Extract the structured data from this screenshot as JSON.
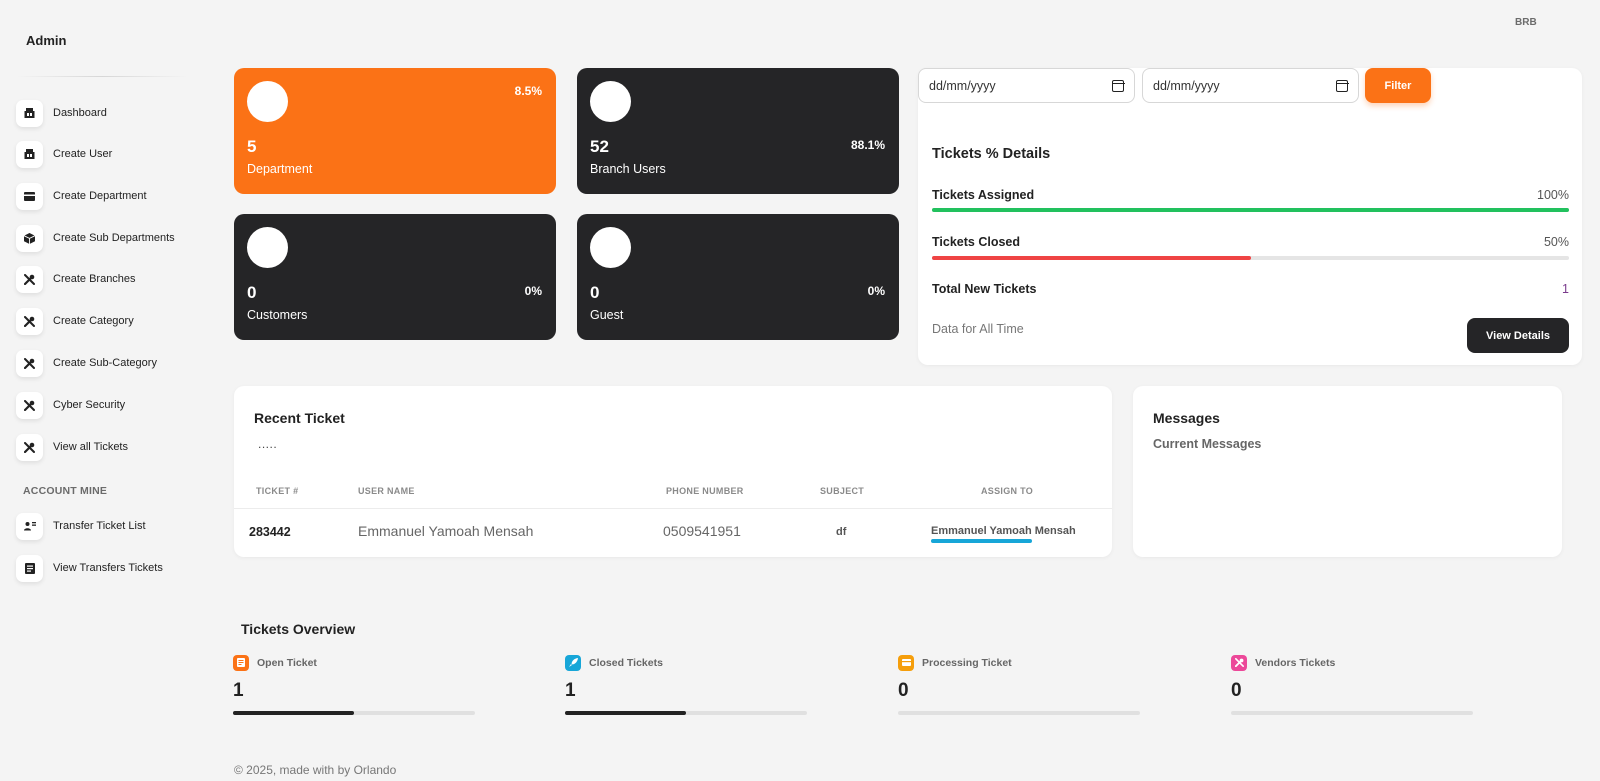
{
  "sidebar": {
    "brand": "Admin",
    "items": [
      {
        "label": "Dashboard",
        "icon": "shop-icon"
      },
      {
        "label": "Create User",
        "icon": "shop-icon"
      },
      {
        "label": "Create Department",
        "icon": "credit-card-icon"
      },
      {
        "label": "Create Sub Departments",
        "icon": "box-icon"
      },
      {
        "label": "Create Branches",
        "icon": "tools-icon"
      },
      {
        "label": "Create Category",
        "icon": "tools-icon"
      },
      {
        "label": "Create Sub-Category",
        "icon": "tools-icon"
      },
      {
        "label": "Cyber Security",
        "icon": "tools-icon"
      },
      {
        "label": "View all Tickets",
        "icon": "tools-icon"
      }
    ],
    "section_label": "ACCOUNT MINE",
    "account_items": [
      {
        "label": "Transfer Ticket List",
        "icon": "user-transfer-icon"
      },
      {
        "label": "View Transfers Tickets",
        "icon": "document-icon"
      }
    ]
  },
  "header": {
    "user": "BRB"
  },
  "stats": [
    {
      "value": "5",
      "label": "Department",
      "percent": "8.5%",
      "color": "#fb7216"
    },
    {
      "value": "52",
      "label": "Branch Users",
      "percent": "88.1%",
      "color": "#252527"
    },
    {
      "value": "0",
      "label": "Customers",
      "percent": "0%",
      "color": "#252527"
    },
    {
      "value": "0",
      "label": "Guest",
      "percent": "0%",
      "color": "#252527"
    }
  ],
  "filter": {
    "start_placeholder": "dd/mm/yyyy",
    "end_placeholder": "dd/mm/yyyy",
    "button_label": "Filter"
  },
  "tickets_percent": {
    "title": "Tickets % Details",
    "assigned": {
      "label": "Tickets Assigned",
      "value": "100%",
      "fraction": 1.0,
      "color": "#22c15e"
    },
    "closed": {
      "label": "Tickets Closed",
      "value": "50%",
      "fraction": 0.5,
      "color": "#ef4444"
    },
    "total_new": {
      "label": "Total New Tickets",
      "value": "1"
    },
    "note": "Data for All Time",
    "button_label": "View Details"
  },
  "recent_ticket": {
    "title": "Recent Ticket",
    "dots": ".....",
    "columns": [
      "TICKET #",
      "USER NAME",
      "PHONE NUMBER",
      "SUBJECT",
      "ASSIGN TO"
    ],
    "rows": [
      {
        "ticket": "283442",
        "user": "Emmanuel Yamoah Mensah",
        "phone": "0509541951",
        "subject": "df",
        "assign": "Emmanuel Yamoah Mensah"
      }
    ]
  },
  "messages": {
    "title": "Messages",
    "subtitle": "Current Messages"
  },
  "overview": {
    "title": "Tickets Overview",
    "items": [
      {
        "label": "Open Ticket",
        "value": "1",
        "fraction": 0.5,
        "icon": "note-icon",
        "color": "#fb7216"
      },
      {
        "label": "Closed Tickets",
        "value": "1",
        "fraction": 0.5,
        "icon": "rocket-icon",
        "color": "#17a6d8"
      },
      {
        "label": "Processing Ticket",
        "value": "0",
        "fraction": 0,
        "icon": "credit-card-icon",
        "color": "#f59e0b"
      },
      {
        "label": "Vendors Tickets",
        "value": "0",
        "fraction": 0,
        "icon": "tools-icon",
        "color": "#ec4899"
      }
    ]
  },
  "footer": {
    "text": "© 2025, made with by Orlando"
  }
}
